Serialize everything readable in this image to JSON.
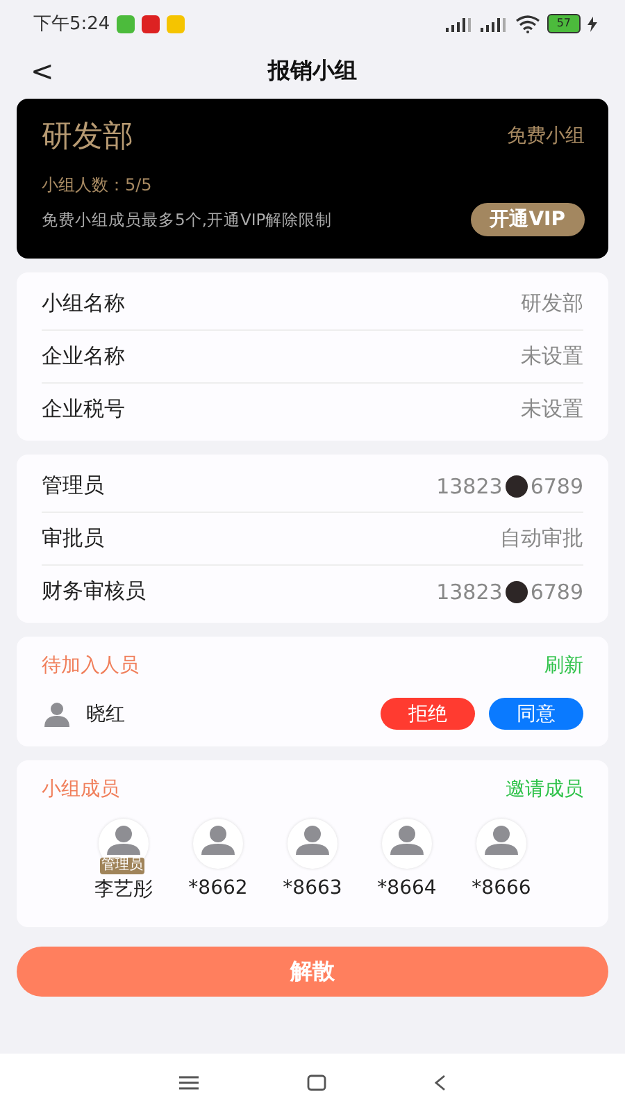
{
  "status_bar": {
    "time": "下午5:24",
    "battery": "57"
  },
  "nav": {
    "back": "<",
    "title": "报销小组"
  },
  "vip_card": {
    "name": "研发部",
    "plan": "免费小组",
    "count": "小组人数：5/5",
    "note": "免费小组成员最多5个,开通VIP解除限制",
    "button": "开通VIP"
  },
  "info": [
    {
      "label": "小组名称",
      "value": "研发部"
    },
    {
      "label": "企业名称",
      "value": "未设置"
    },
    {
      "label": "企业税号",
      "value": "未设置"
    }
  ],
  "roles": [
    {
      "label": "管理员",
      "value": "13823",
      "value_end": "6789",
      "redacted": true
    },
    {
      "label": "审批员",
      "value": "自动审批",
      "redacted": false
    },
    {
      "label": "财务审核员",
      "value": "13823",
      "value_end": "6789",
      "redacted": true
    }
  ],
  "pending": {
    "title": "待加入人员",
    "action": "刷新",
    "people": [
      {
        "name": "晓红",
        "reject": "拒绝",
        "accept": "同意"
      }
    ]
  },
  "members": {
    "title": "小组成员",
    "action": "邀请成员",
    "people": [
      {
        "name": "李艺彤",
        "badge": "管理员"
      },
      {
        "name": "*8662"
      },
      {
        "name": "*8663"
      },
      {
        "name": "*8664"
      },
      {
        "name": "*8666"
      }
    ]
  },
  "dissolve_button": "解散"
}
